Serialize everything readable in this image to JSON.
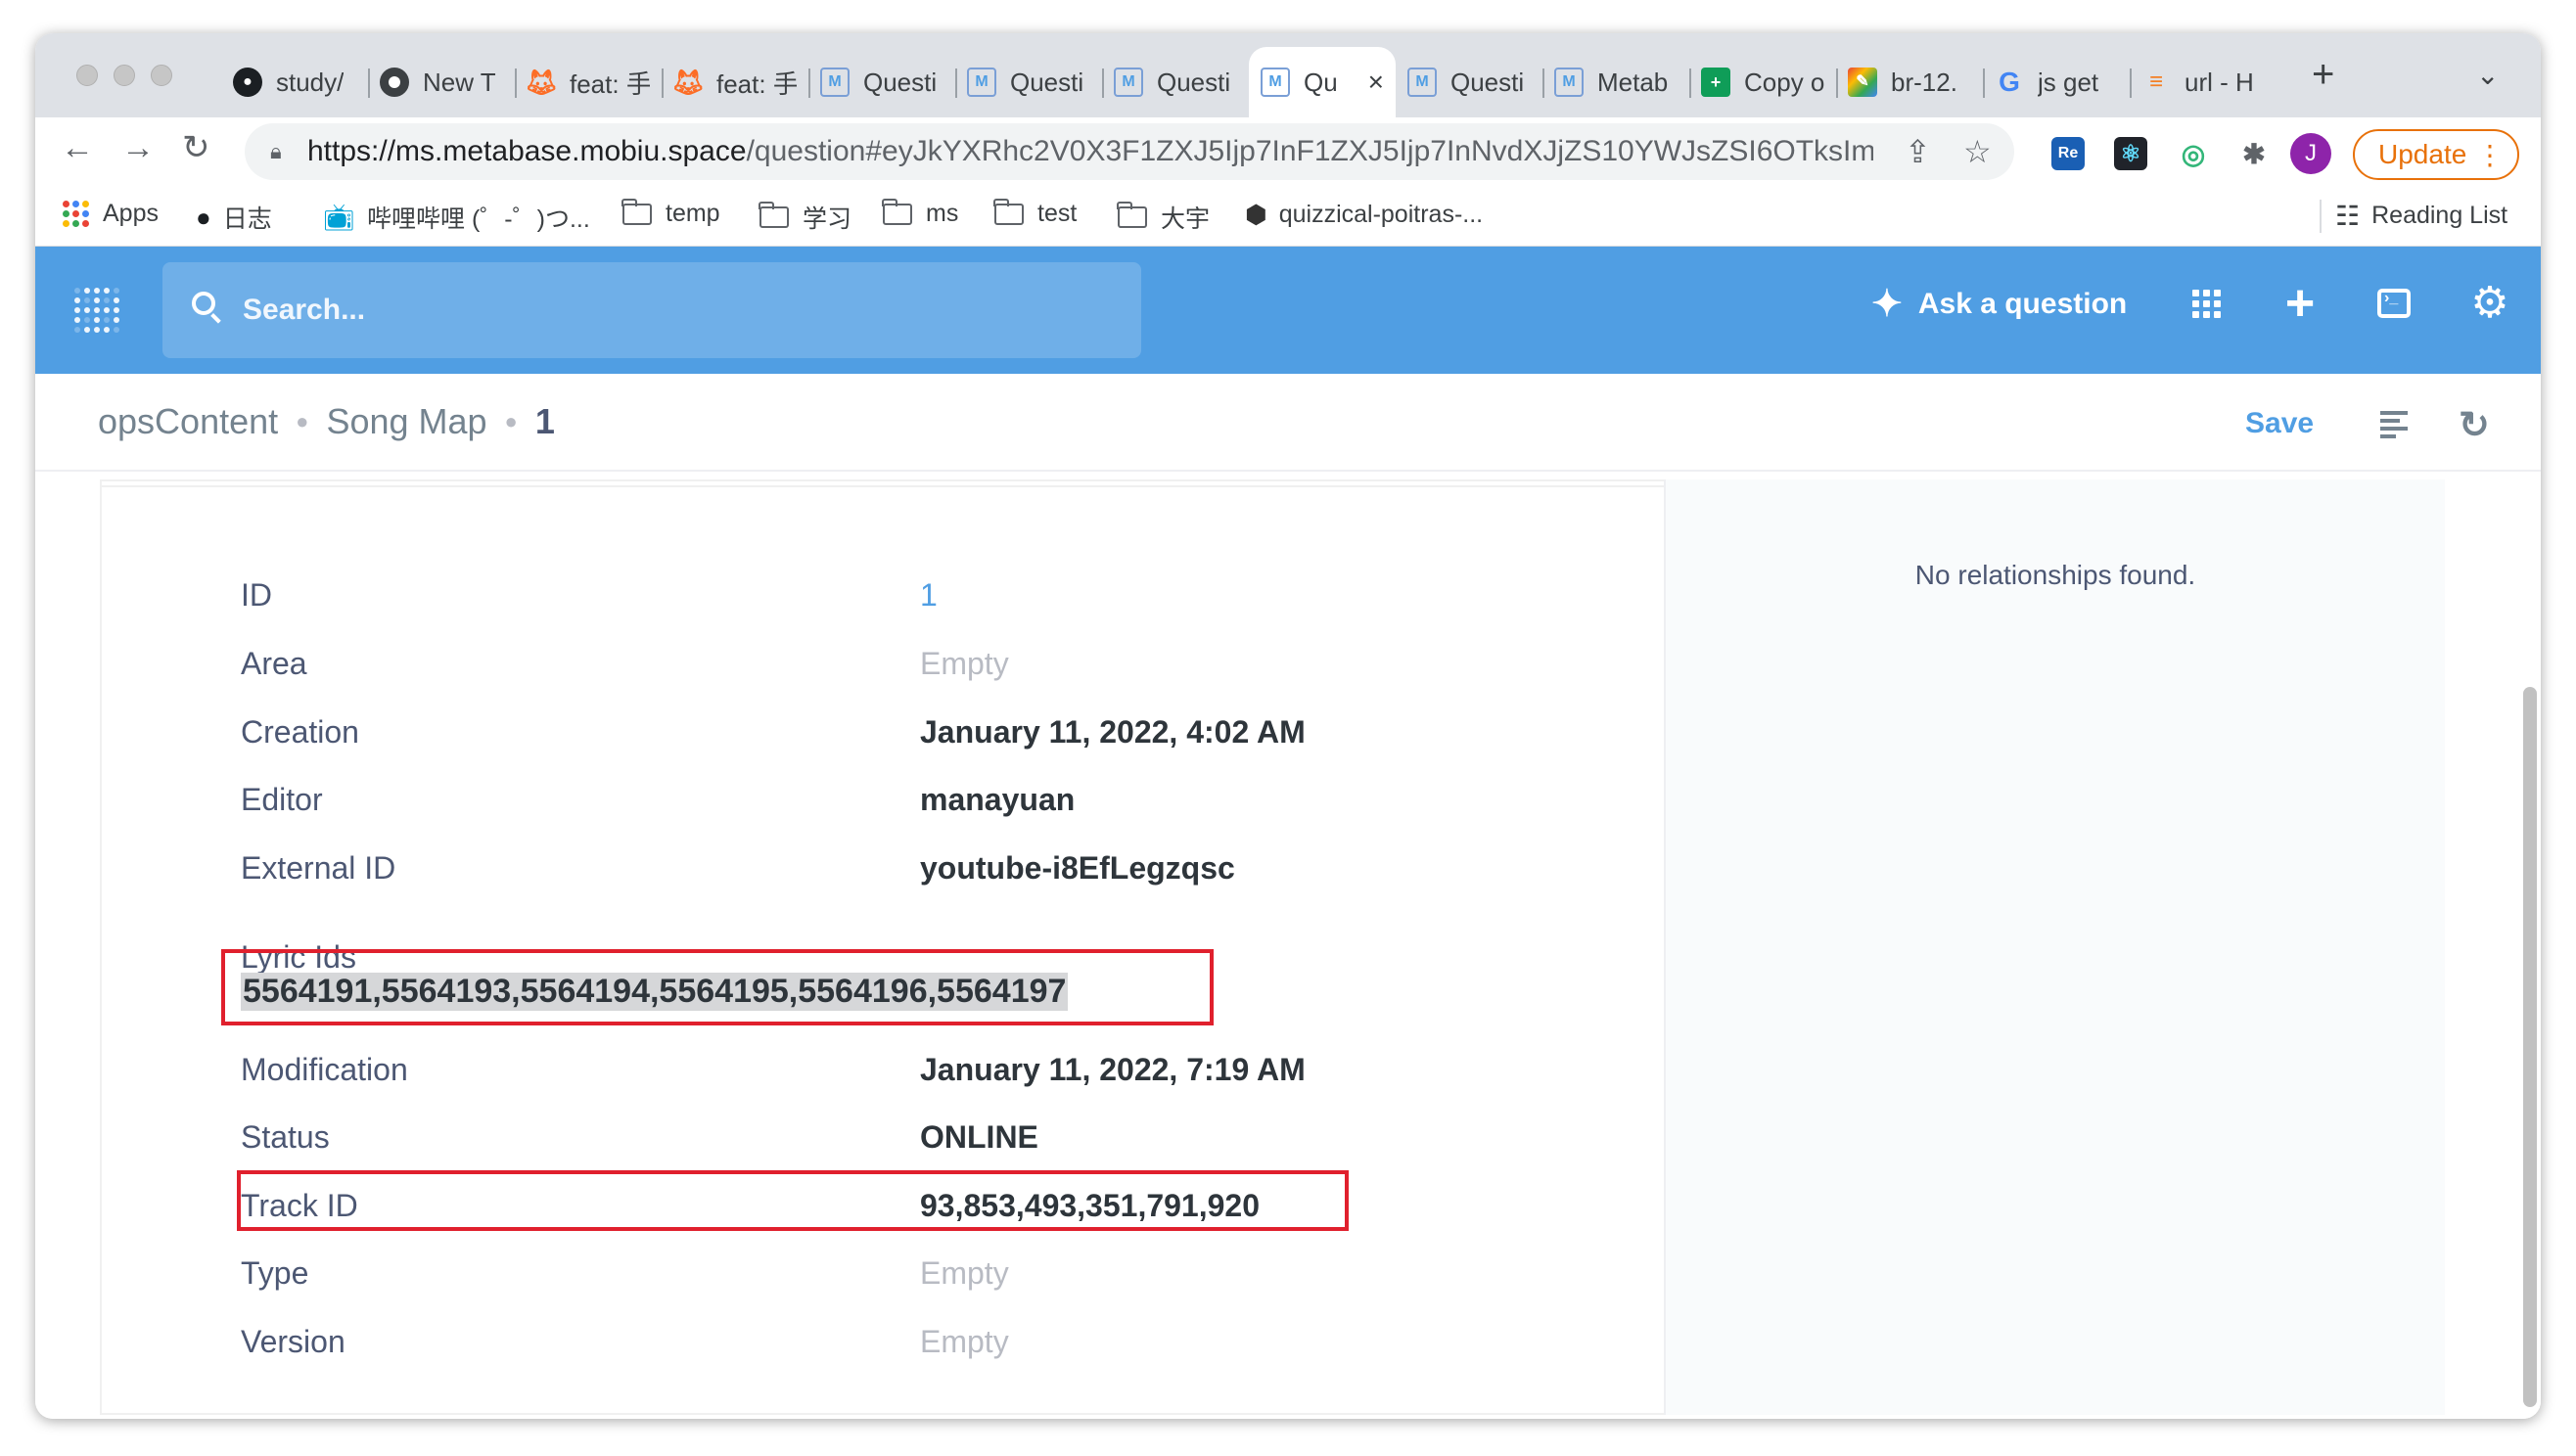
{
  "browser": {
    "tabs": [
      {
        "icon": "github-icon",
        "title": "study/"
      },
      {
        "icon": "chrome-icon",
        "title": "New T"
      },
      {
        "icon": "gitlab-icon",
        "title": "feat: 手"
      },
      {
        "icon": "gitlab-icon",
        "title": "feat: 手"
      },
      {
        "icon": "metabase-icon",
        "title": "Questi"
      },
      {
        "icon": "metabase-icon",
        "title": "Questi"
      },
      {
        "icon": "metabase-icon",
        "title": "Questi"
      },
      {
        "icon": "metabase-icon",
        "title": "Qu",
        "active": true
      },
      {
        "icon": "metabase-icon",
        "title": "Questi"
      },
      {
        "icon": "metabase-icon",
        "title": "Metab"
      },
      {
        "icon": "sheets-icon",
        "title": "Copy o"
      },
      {
        "icon": "colorful-icon",
        "title": "br-12."
      },
      {
        "icon": "google-icon",
        "title": "js get"
      },
      {
        "icon": "stackoverflow-icon",
        "title": "url - H"
      }
    ],
    "url_host": "https://ms.metabase.mobiu.space",
    "url_path": "/question#eyJkYXRhc2V0X3F1ZXJ5Ijp7InF1ZXJ5Ijp7InNvdXJjZS10YWJsZSI6OTksImZ...",
    "update_label": "Update",
    "profile_initial": "J",
    "bookmarks": [
      {
        "icon": "apps-grid-icon",
        "label": "Apps"
      },
      {
        "icon": "github-icon",
        "label": "日志"
      },
      {
        "icon": "bilibili-icon",
        "label": "哔哩哔哩 (゜-゜)つ..."
      },
      {
        "icon": "folder-icon",
        "label": "temp"
      },
      {
        "icon": "folder-icon",
        "label": "学习"
      },
      {
        "icon": "folder-icon",
        "label": "ms"
      },
      {
        "icon": "folder-icon",
        "label": "test"
      },
      {
        "icon": "folder-icon",
        "label": "大宇"
      },
      {
        "icon": "cube-icon",
        "label": "quizzical-poitras-..."
      }
    ],
    "reading_list": "Reading List"
  },
  "metabase": {
    "search_placeholder": "Search...",
    "ask_question": "Ask a question",
    "brand_color": "#509ee3"
  },
  "breadcrumb": {
    "database": "opsContent",
    "table": "Song Map",
    "record": "1",
    "save_label": "Save"
  },
  "record": {
    "fields": [
      {
        "label": "ID",
        "value": "1",
        "style": "link"
      },
      {
        "label": "Area",
        "value": "Empty",
        "style": "empty"
      },
      {
        "label": "Creation",
        "value": "January 11, 2022, 4:02 AM",
        "style": "bold"
      },
      {
        "label": "Editor",
        "value": "manayuan",
        "style": "bold"
      },
      {
        "label": "External ID",
        "value": "youtube-i8EfLegzqsc",
        "style": "bold"
      }
    ],
    "lyric_label": "Lyric Ids",
    "lyric_value": "5564191,5564193,5564194,5564195,5564196,5564197",
    "fields_after": [
      {
        "label": "Modification",
        "value": "January 11, 2022, 7:19 AM",
        "style": "bold"
      },
      {
        "label": "Status",
        "value": "ONLINE",
        "style": "bold"
      },
      {
        "label": "Track ID",
        "value": "93,853,493,351,791,920",
        "style": "bold"
      },
      {
        "label": "Type",
        "value": "Empty",
        "style": "empty"
      },
      {
        "label": "Version",
        "value": "Empty",
        "style": "empty"
      }
    ],
    "relationships_text": "No relationships found.",
    "highlight_color": "#e0202d"
  }
}
